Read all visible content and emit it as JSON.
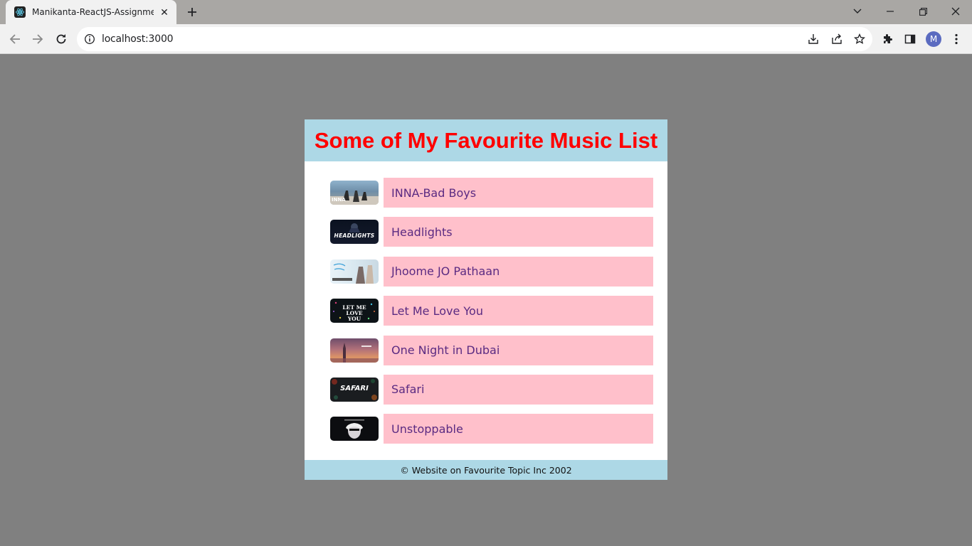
{
  "browser": {
    "tab_title": "Manikanta-ReactJS-Assignment-",
    "url": "localhost:3000",
    "profile_initial": "M"
  },
  "page": {
    "title": "Some of My Favourite Music List",
    "songs": [
      {
        "title": "INNA-Bad Boys",
        "thumb_text": "INNA"
      },
      {
        "title": "Headlights",
        "thumb_text": "HEADLIGHTS"
      },
      {
        "title": "Jhoome JO Pathaan",
        "thumb_text": ""
      },
      {
        "title": "Let Me Love You",
        "thumb_text": "LET ME LOVE YOU"
      },
      {
        "title": "One Night in Dubai",
        "thumb_text": ""
      },
      {
        "title": "Safari",
        "thumb_text": "SAFARI"
      },
      {
        "title": "Unstoppable",
        "thumb_text": ""
      }
    ],
    "footer": "© Website on Favourite Topic Inc 2002"
  },
  "colors": {
    "page_bg": "#808080",
    "header_bg": "#add8e6",
    "title_color": "#ff0000",
    "song_box_bg": "#ffc0cb",
    "song_text_color": "#5a2a82"
  }
}
